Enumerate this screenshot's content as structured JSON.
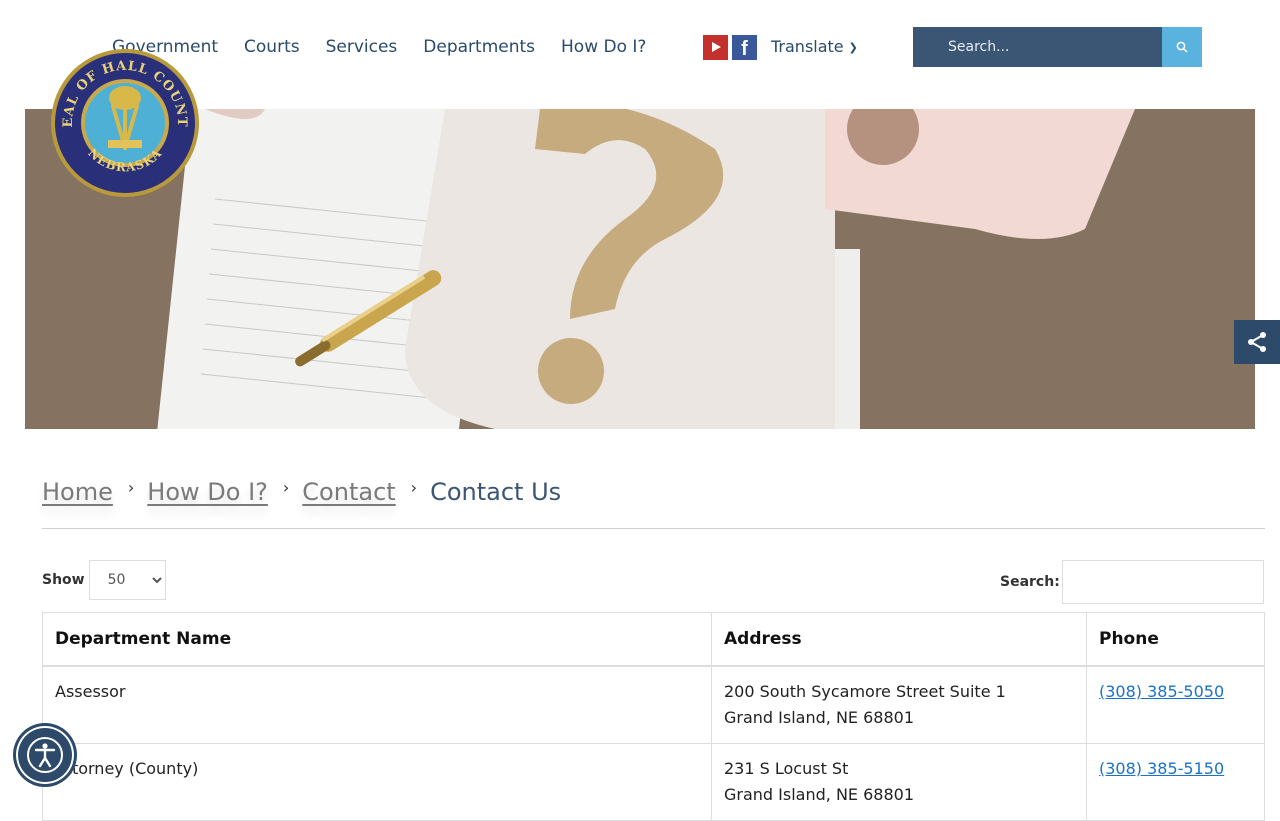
{
  "nav": {
    "items": [
      {
        "label": "Government"
      },
      {
        "label": "Courts"
      },
      {
        "label": "Services"
      },
      {
        "label": "Departments"
      },
      {
        "label": "How Do I?"
      }
    ],
    "translate_label": "Translate"
  },
  "seal": {
    "top_text": "SEAL OF HALL COUNTY",
    "bottom_text": "NEBRASKA"
  },
  "header_search": {
    "placeholder": "Search..."
  },
  "breadcrumb": {
    "items": [
      {
        "label": "Home"
      },
      {
        "label": "How Do I?"
      },
      {
        "label": "Contact"
      }
    ],
    "current": "Contact Us"
  },
  "table_controls": {
    "show_label": "Show",
    "show_value": "50",
    "search_label": "Search:"
  },
  "table": {
    "headers": [
      "Department Name",
      "Address",
      "Phone"
    ],
    "rows": [
      {
        "name": "Assessor",
        "address_line1": "200 South Sycamore Street Suite 1",
        "address_line2": "Grand Island, NE 68801",
        "phone": "(308) 385-5050"
      },
      {
        "name": "Attorney (County)",
        "address_line1": "231 S Locust St",
        "address_line2": "Grand Island, NE 68801",
        "phone": "(308) 385-5150"
      }
    ]
  },
  "colors": {
    "nav_text": "#2a4a6b",
    "search_bg": "#3b5574",
    "search_button": "#5ab3df",
    "share_tab": "#2d4a6b",
    "link": "#1a73c8"
  }
}
